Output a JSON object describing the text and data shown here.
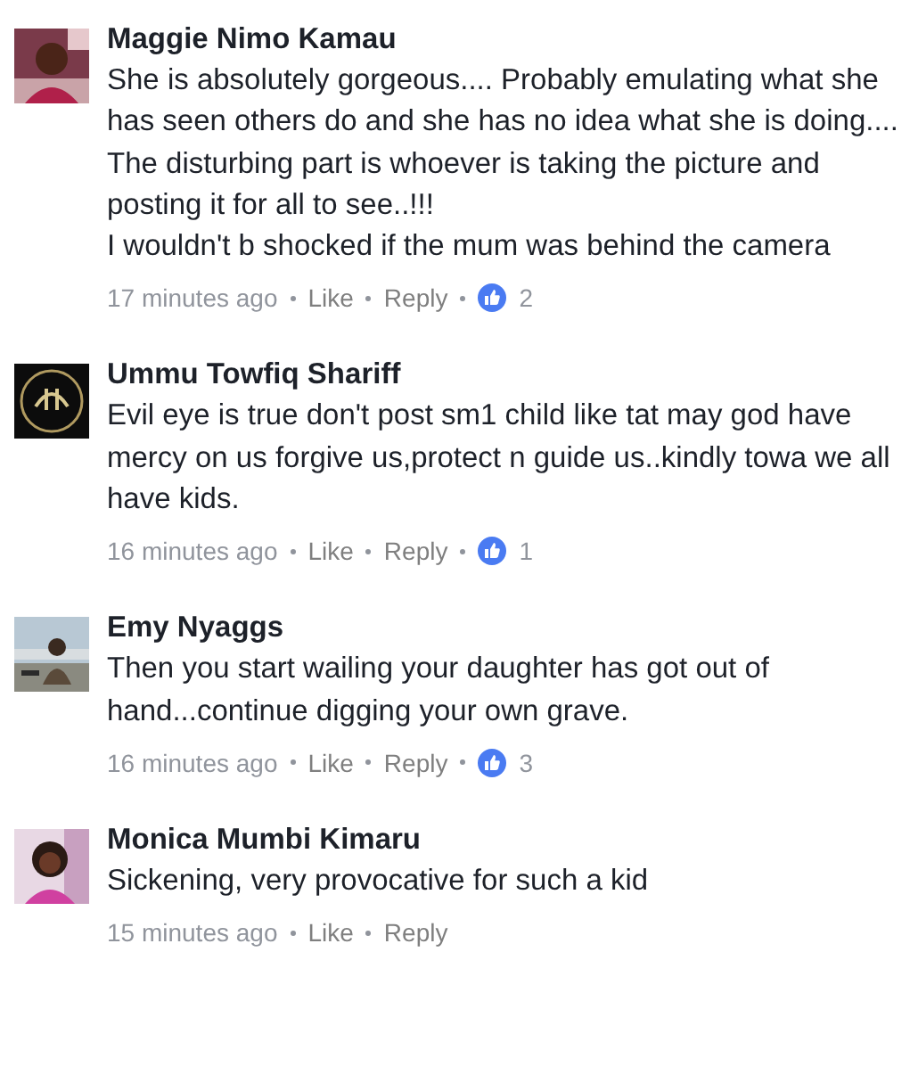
{
  "comments": [
    {
      "name": "Maggie Nimo Kamau",
      "text": "She is absolutely gorgeous.... Probably emulating what she has seen others do and she has no idea what she is doing....\nThe disturbing part is whoever is taking the picture and posting it for all to see..!!!\nI wouldn't b shocked if the mum was behind the camera",
      "time": "17 minutes ago",
      "like": "Like",
      "reply": "Reply",
      "reactions": "2"
    },
    {
      "name": "Ummu Towfiq Shariff",
      "text": "Evil eye is true don't post sm1 child like tat may god have mercy on us forgive us,protect n guide us..kindly towa we all have kids.",
      "time": "16 minutes ago",
      "like": "Like",
      "reply": "Reply",
      "reactions": "1"
    },
    {
      "name": "Emy Nyaggs",
      "text": "Then you start wailing your daughter has got out of hand...continue digging your own grave.",
      "time": "16 minutes ago",
      "like": "Like",
      "reply": "Reply",
      "reactions": "3"
    },
    {
      "name": "Monica Mumbi Kimaru",
      "text": "Sickening, very provocative for such a kid",
      "time": "15 minutes ago",
      "like": "Like",
      "reply": "Reply"
    }
  ]
}
